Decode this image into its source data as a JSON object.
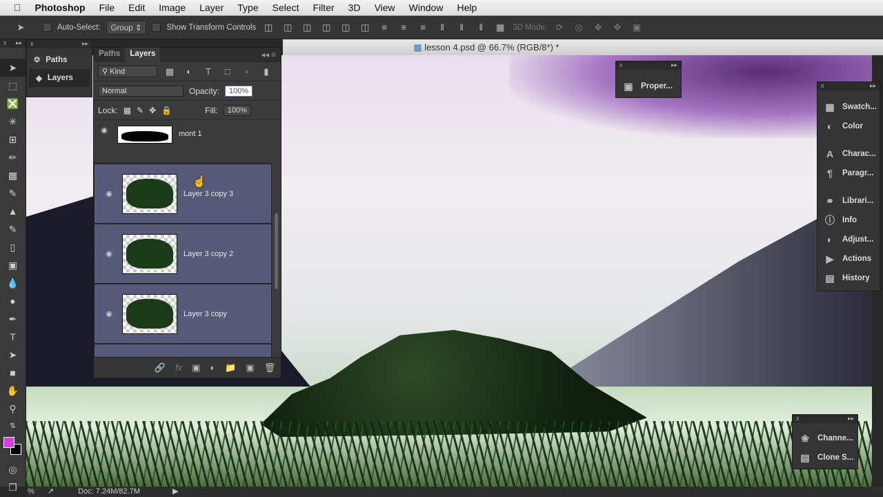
{
  "menubar": {
    "app": "Photoshop",
    "items": [
      "File",
      "Edit",
      "Image",
      "Layer",
      "Type",
      "Select",
      "Filter",
      "3D",
      "View",
      "Window",
      "Help"
    ]
  },
  "options": {
    "auto_select": "Auto-Select:",
    "group": "Group",
    "show_transform": "Show Transform Controls",
    "mode3d": "3D Mode:"
  },
  "document": {
    "title": "lesson 4.psd @ 66.7% (RGB/8*) *"
  },
  "dock": {
    "paths": "Paths",
    "layers": "Layers"
  },
  "layers_panel": {
    "tabs": [
      "Paths",
      "Layers"
    ],
    "filter": "Kind",
    "blend": "Normal",
    "opacity_label": "Opacity:",
    "opacity": "100%",
    "lock_label": "Lock:",
    "fill_label": "Fill:",
    "fill": "100%",
    "layers": [
      {
        "name": "mont 1",
        "selected": false
      },
      {
        "name": "Layer 3 copy 3",
        "selected": true
      },
      {
        "name": "Layer 3 copy 2",
        "selected": true
      },
      {
        "name": "Layer 3 copy",
        "selected": true
      }
    ]
  },
  "properties": {
    "label": "Proper..."
  },
  "right_dock": [
    "Swatch...",
    "Color",
    "Charac...",
    "Paragr...",
    "Librari...",
    "Info",
    "Adjust...",
    "Actions",
    "History"
  ],
  "bottom_dock": [
    "Channe...",
    "Clone S..."
  ],
  "status": {
    "zoom": "%",
    "doc": "Doc: 7.24M/82.7M"
  },
  "colors": {
    "foreground": "#d93fe0",
    "background": "#000000",
    "selection": "#575a78"
  }
}
